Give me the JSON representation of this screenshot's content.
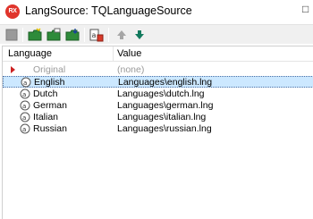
{
  "window": {
    "title": "LangSource: TQLanguageSource",
    "app_icon_text": "RX",
    "titlebar_button": "□"
  },
  "toolbar": {
    "buttons": [
      {
        "name": "stop-button",
        "icon": "stop-square-icon"
      },
      {
        "name": "new-folder-button",
        "icon": "folder-new-icon"
      },
      {
        "name": "open-folder-button",
        "icon": "folder-open-icon"
      },
      {
        "name": "save-folder-button",
        "icon": "folder-save-icon"
      },
      {
        "name": "language-button",
        "icon": "translate-icon"
      },
      {
        "name": "move-up-button",
        "icon": "arrow-up-icon"
      },
      {
        "name": "move-down-button",
        "icon": "arrow-down-icon"
      }
    ]
  },
  "columns": {
    "language": "Language",
    "value": "Value"
  },
  "rows": [
    {
      "language": "Original",
      "value": "(none)",
      "state": "original"
    },
    {
      "language": "English",
      "value": "Languages\\english.lng",
      "state": "selected"
    },
    {
      "language": "Dutch",
      "value": "Languages\\dutch.lng",
      "state": "normal"
    },
    {
      "language": "German",
      "value": "Languages\\german.lng",
      "state": "normal"
    },
    {
      "language": "Italian",
      "value": "Languages\\italian.lng",
      "state": "normal"
    },
    {
      "language": "Russian",
      "value": "Languages\\russian.lng",
      "state": "normal"
    }
  ],
  "colors": {
    "selection": "#cce8ff",
    "accent_red": "#e0342b",
    "toolbar_bg": "#f0f0f0"
  }
}
